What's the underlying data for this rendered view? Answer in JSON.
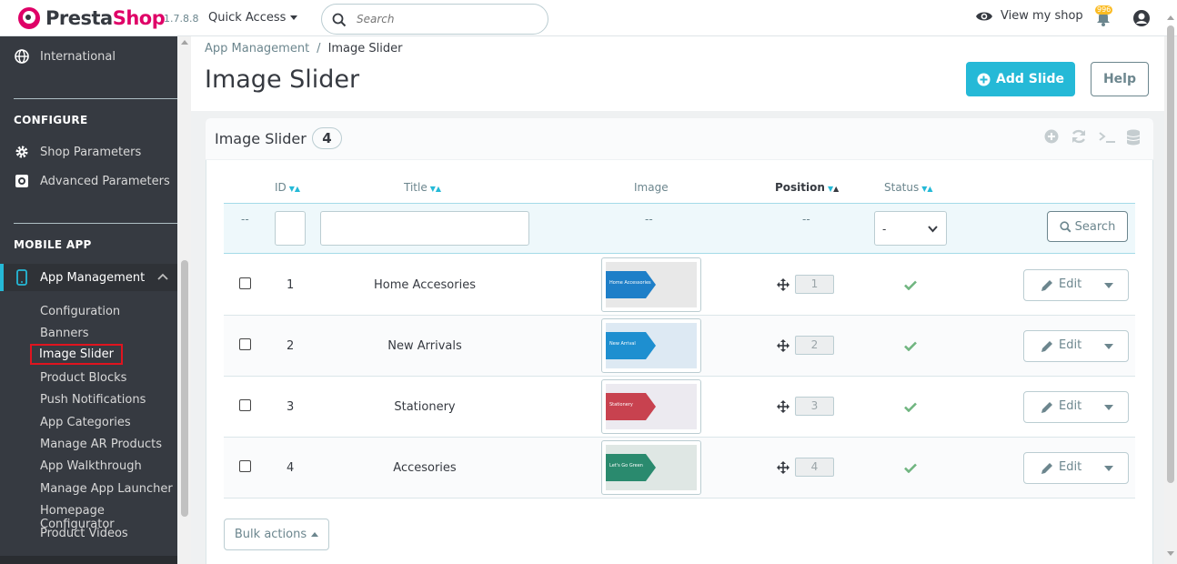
{
  "header": {
    "brand_part1": "Presta",
    "brand_part2": "Shop",
    "version": "1.7.8.8",
    "quick_access": "Quick Access",
    "search_placeholder": "Search",
    "view_shop": "View my shop",
    "notifications_count": "996"
  },
  "sidebar": {
    "international": "International",
    "configure_heading": "CONFIGURE",
    "shop_parameters": "Shop Parameters",
    "advanced_parameters": "Advanced Parameters",
    "mobile_heading": "MOBILE APP",
    "app_management": "App Management",
    "sub_items": [
      "Configuration",
      "Banners",
      "Image Slider",
      "Product Blocks",
      "Push Notifications",
      "App Categories",
      "Manage AR Products",
      "App Walkthrough",
      "Manage App Launcher",
      "Homepage Configurator",
      "Product Videos"
    ],
    "active_sub_index": 2
  },
  "page": {
    "breadcrumb_parent": "App Management",
    "breadcrumb_sep": "/",
    "breadcrumb_current": "Image Slider",
    "title": "Image Slider",
    "add_button": "Add Slide",
    "help_button": "Help"
  },
  "panel": {
    "title": "Image Slider",
    "count": "4",
    "columns": {
      "id": "ID",
      "title": "Title",
      "image": "Image",
      "position": "Position",
      "status": "Status"
    },
    "filter_dashes": "--",
    "status_select": "-",
    "search_button": "Search",
    "edit_label": "Edit",
    "bulk_actions": "Bulk actions",
    "rows": [
      {
        "id": "1",
        "title": "Home Accesories",
        "position": "1",
        "banner_text": "Home Accessories",
        "banner_color": "#1e7fc8",
        "bg": "#e8e8e8"
      },
      {
        "id": "2",
        "title": "New Arrivals",
        "position": "2",
        "banner_text": "New Arrival",
        "banner_color": "#1e8fd0",
        "bg": "#dde9f3"
      },
      {
        "id": "3",
        "title": "Stationery",
        "position": "3",
        "banner_text": "Stationery",
        "banner_color": "#c8424f",
        "bg": "#eceaf0"
      },
      {
        "id": "4",
        "title": "Accesories",
        "position": "4",
        "banner_text": "Let's Go Green",
        "banner_color": "#2a8a6e",
        "bg": "#dfe7e4"
      }
    ]
  },
  "colors": {
    "accent": "#25b9d7",
    "brand": "#df0067",
    "sidebar_bg": "#363a41",
    "success": "#70b580"
  }
}
